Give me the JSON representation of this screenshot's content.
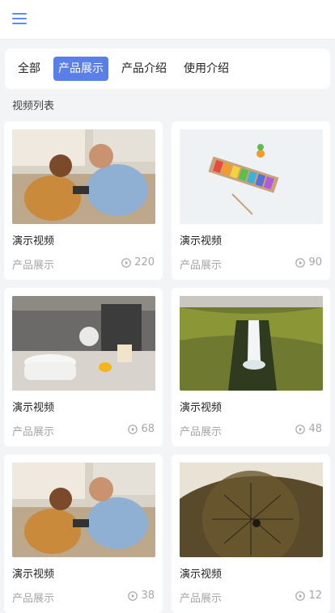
{
  "header": {
    "menu_icon": "hamburger-menu-icon"
  },
  "tabs": [
    {
      "label": "全部",
      "active": false
    },
    {
      "label": "产品展示",
      "active": true
    },
    {
      "label": "产品介绍",
      "active": false
    },
    {
      "label": "使用介绍",
      "active": false
    }
  ],
  "section_title": "视频列表",
  "videos": [
    {
      "title": "演示视频",
      "category": "产品展示",
      "views": "220",
      "thumb": "two-men-on-couch"
    },
    {
      "title": "演示视频",
      "category": "产品展示",
      "views": "90",
      "thumb": "xylophone-toy"
    },
    {
      "title": "演示视频",
      "category": "产品展示",
      "views": "68",
      "thumb": "kitchen-appliances"
    },
    {
      "title": "演示视频",
      "category": "产品展示",
      "views": "48",
      "thumb": "waterfall-canyon"
    },
    {
      "title": "演示视频",
      "category": "产品展示",
      "views": "38",
      "thumb": "two-men-on-couch"
    },
    {
      "title": "演示视频",
      "category": "产品展示",
      "views": "12",
      "thumb": "aerial-climber"
    }
  ],
  "colors": {
    "accent": "#5b7fe8",
    "muted_text": "#a6a6a6",
    "background": "#f3f4f6"
  }
}
